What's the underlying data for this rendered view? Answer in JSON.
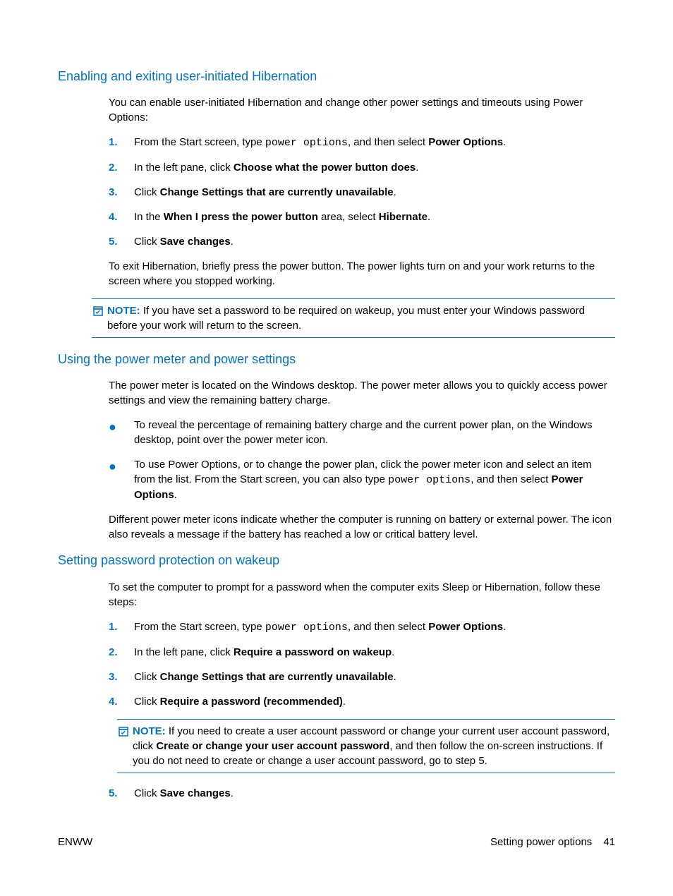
{
  "sections": {
    "s1": {
      "heading": "Enabling and exiting user-initiated Hibernation",
      "intro": "You can enable user-initiated Hibernation and change other power settings and timeouts using Power Options:",
      "steps": [
        {
          "num": "1.",
          "parts": [
            {
              "t": "From the Start screen, type "
            },
            {
              "t": "power options",
              "code": true
            },
            {
              "t": ", and then select "
            },
            {
              "t": "Power Options",
              "b": true
            },
            {
              "t": "."
            }
          ]
        },
        {
          "num": "2.",
          "parts": [
            {
              "t": "In the left pane, click "
            },
            {
              "t": "Choose what the power button does",
              "b": true
            },
            {
              "t": "."
            }
          ]
        },
        {
          "num": "3.",
          "parts": [
            {
              "t": "Click "
            },
            {
              "t": "Change Settings that are currently unavailable",
              "b": true
            },
            {
              "t": "."
            }
          ]
        },
        {
          "num": "4.",
          "parts": [
            {
              "t": "In the "
            },
            {
              "t": "When I press the power button",
              "b": true
            },
            {
              "t": " area, select "
            },
            {
              "t": "Hibernate",
              "b": true
            },
            {
              "t": "."
            }
          ]
        },
        {
          "num": "5.",
          "parts": [
            {
              "t": "Click "
            },
            {
              "t": "Save changes",
              "b": true
            },
            {
              "t": "."
            }
          ]
        }
      ],
      "outro": "To exit Hibernation, briefly press the power button. The power lights turn on and your work returns to the screen where you stopped working.",
      "note": {
        "label": "NOTE:",
        "parts": [
          {
            "t": "If you have set a password to be required on wakeup, you must enter your Windows password before your work will return to the screen."
          }
        ]
      }
    },
    "s2": {
      "heading": "Using the power meter and power settings",
      "intro": "The power meter is located on the Windows desktop. The power meter allows you to quickly access power settings and view the remaining battery charge.",
      "bullets": [
        {
          "parts": [
            {
              "t": "To reveal the percentage of remaining battery charge and the current power plan, on the Windows desktop, point over the power meter icon."
            }
          ]
        },
        {
          "parts": [
            {
              "t": "To use Power Options, or to change the power plan, click the power meter icon and select an item from the list. From the Start screen, you can also type "
            },
            {
              "t": "power options",
              "code": true
            },
            {
              "t": ", and then select "
            },
            {
              "t": "Power Options",
              "b": true
            },
            {
              "t": "."
            }
          ]
        }
      ],
      "outro": "Different power meter icons indicate whether the computer is running on battery or external power. The icon also reveals a message if the battery has reached a low or critical battery level."
    },
    "s3": {
      "heading": "Setting password protection on wakeup",
      "intro": "To set the computer to prompt for a password when the computer exits Sleep or Hibernation, follow these steps:",
      "steps_a": [
        {
          "num": "1.",
          "parts": [
            {
              "t": "From the Start screen, type "
            },
            {
              "t": "power options",
              "code": true
            },
            {
              "t": ", and then select "
            },
            {
              "t": "Power Options",
              "b": true
            },
            {
              "t": "."
            }
          ]
        },
        {
          "num": "2.",
          "parts": [
            {
              "t": "In the left pane, click "
            },
            {
              "t": "Require a password on wakeup",
              "b": true
            },
            {
              "t": "."
            }
          ]
        },
        {
          "num": "3.",
          "parts": [
            {
              "t": "Click "
            },
            {
              "t": "Change Settings that are currently unavailable",
              "b": true
            },
            {
              "t": "."
            }
          ]
        },
        {
          "num": "4.",
          "parts": [
            {
              "t": "Click "
            },
            {
              "t": "Require a password (recommended)",
              "b": true
            },
            {
              "t": "."
            }
          ]
        }
      ],
      "note": {
        "label": "NOTE:",
        "parts": [
          {
            "t": "If you need to create a user account password or change your current user account password, click "
          },
          {
            "t": "Create or change your user account password",
            "b": true
          },
          {
            "t": ", and then follow the on-screen instructions. If you do not need to create or change a user account password, go to step 5."
          }
        ]
      },
      "steps_b": [
        {
          "num": "5.",
          "parts": [
            {
              "t": "Click "
            },
            {
              "t": "Save changes",
              "b": true
            },
            {
              "t": "."
            }
          ]
        }
      ]
    }
  },
  "footer": {
    "left": "ENWW",
    "right_text": "Setting power options",
    "page_num": "41"
  }
}
